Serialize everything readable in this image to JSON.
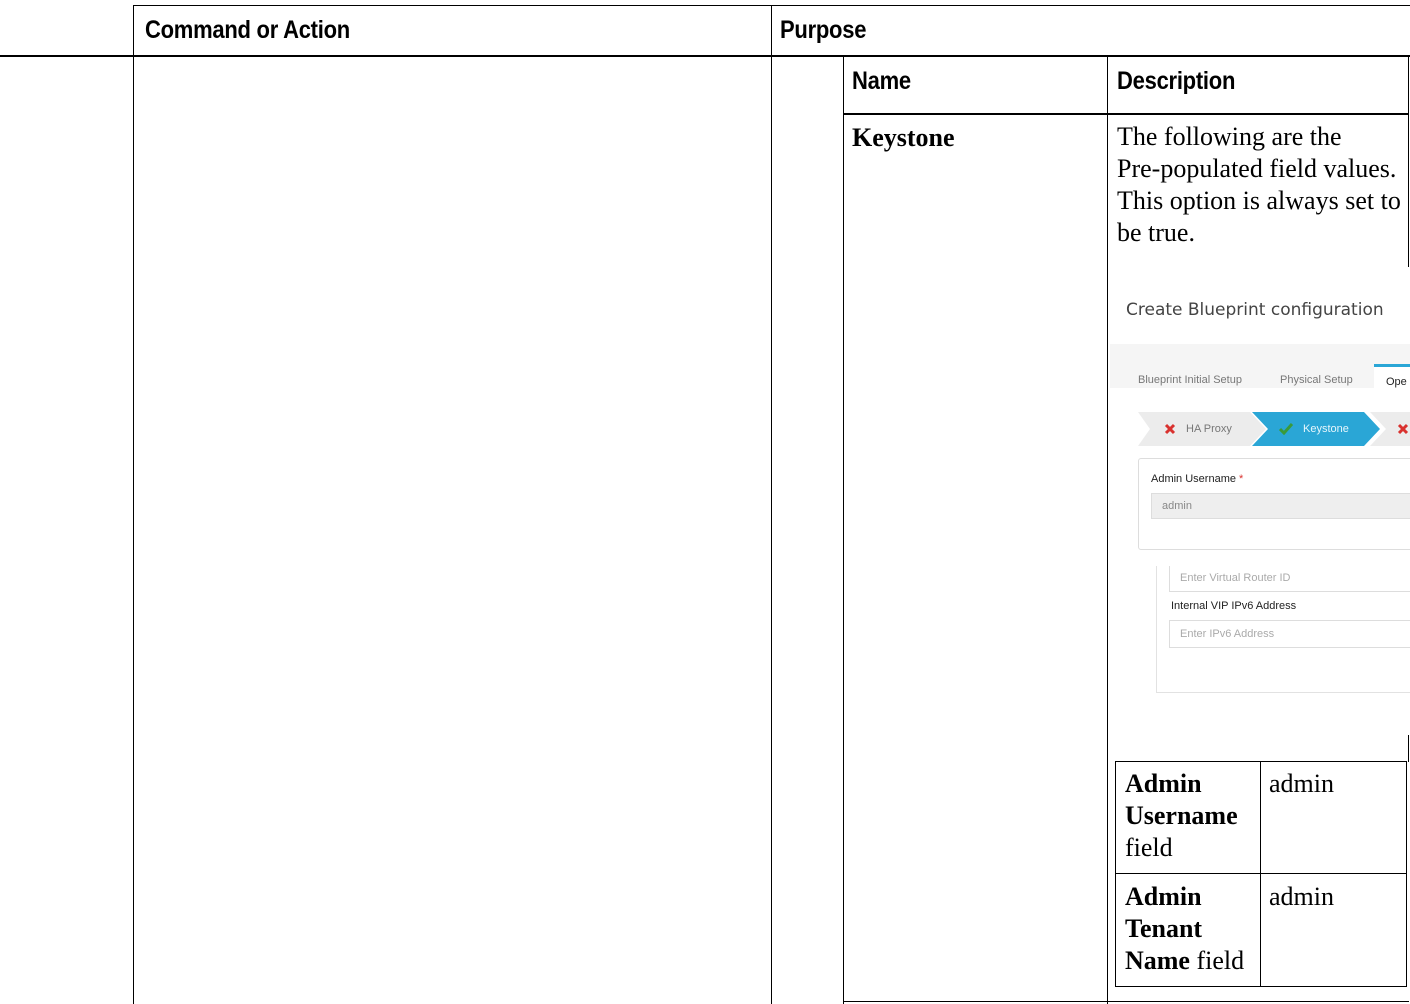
{
  "table": {
    "header_command": "Command or Action",
    "header_purpose": "Purpose"
  },
  "inner_table": {
    "header_name": "Name",
    "header_description": "Description",
    "row_name": "Keystone",
    "row_description": [
      "The following are the",
      "Pre-populated field values.",
      "This option is always set to",
      "be true."
    ]
  },
  "screenshot": {
    "title": "Create Blueprint configuration",
    "tabs": [
      "Blueprint Initial Setup",
      "Physical Setup",
      "Ope"
    ],
    "steps": [
      "HA Proxy",
      "Keystone"
    ],
    "admin_username_label": "Admin Username",
    "required_mark": "*",
    "admin_username_value": "admin",
    "virtual_router_placeholder": "Enter Virtual Router ID",
    "internal_vip_label": "Internal VIP IPv6 Address",
    "ipv6_placeholder": "Enter IPv6 Address",
    "colors": {
      "accent": "#2aa6d6",
      "error": "#d9322f",
      "success": "#3a9a3a"
    }
  },
  "values_table": {
    "rows": [
      {
        "name_bold_1": "Admin",
        "name_bold_2": "Username",
        "name_rest": "field",
        "value": "admin"
      },
      {
        "name_bold_1": "Admin",
        "name_bold_2": "Tenant",
        "name_bold_3": "Name",
        "name_rest": " field",
        "value": "admin"
      }
    ]
  }
}
